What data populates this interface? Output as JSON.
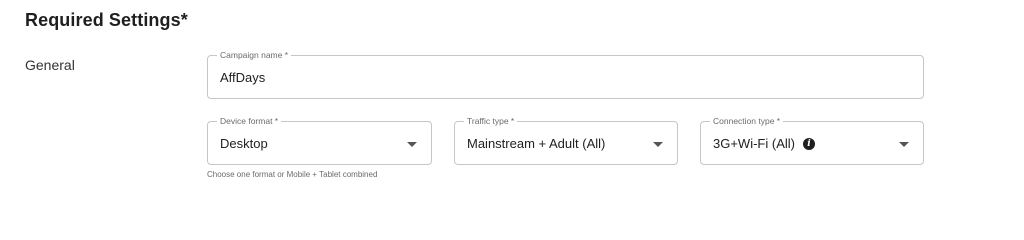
{
  "section": {
    "title": "Required Settings*"
  },
  "general": {
    "label": "General",
    "campaign_name": {
      "legend": "Campaign name *",
      "value": "AffDays"
    },
    "device_format": {
      "legend": "Device format *",
      "value": "Desktop",
      "helper": "Choose one format or Mobile + Tablet combined",
      "icon": "chevron-down-icon"
    },
    "traffic_type": {
      "legend": "Traffic type *",
      "value": "Mainstream + Adult (All)",
      "icon": "chevron-down-icon"
    },
    "connection_type": {
      "legend": "Connection type *",
      "value": "3G+Wi-Fi (All)",
      "info_glyph": "i",
      "icon": "chevron-down-icon"
    }
  },
  "colors": {
    "border": "#c6c6c6",
    "text": "#212121",
    "muted": "#6b6b6b"
  }
}
